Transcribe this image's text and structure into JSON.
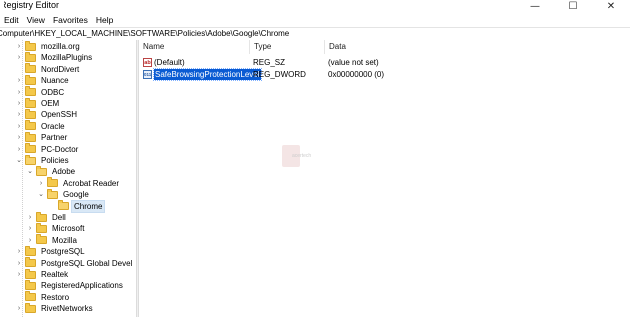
{
  "window": {
    "title": "Registry Editor",
    "minimize": "—",
    "maximize": "☐",
    "close": "✕"
  },
  "menu": [
    "Edit",
    "View",
    "Favorites",
    "Help"
  ],
  "address": "Computer\\HKEY_LOCAL_MACHINE\\SOFTWARE\\Policies\\Adobe\\Google\\Chrome",
  "tree": [
    {
      "label": "mozilla.org",
      "expander": ">",
      "depth": 1
    },
    {
      "label": "MozillaPlugins",
      "expander": ">",
      "depth": 1
    },
    {
      "label": "NordDivert",
      "expander": "",
      "depth": 1
    },
    {
      "label": "Nuance",
      "expander": ">",
      "depth": 1
    },
    {
      "label": "ODBC",
      "expander": ">",
      "depth": 1
    },
    {
      "label": "OEM",
      "expander": ">",
      "depth": 1
    },
    {
      "label": "OpenSSH",
      "expander": ">",
      "depth": 1
    },
    {
      "label": "Oracle",
      "expander": ">",
      "depth": 1
    },
    {
      "label": "Partner",
      "expander": ">",
      "depth": 1
    },
    {
      "label": "PC-Doctor",
      "expander": ">",
      "depth": 1
    },
    {
      "label": "Policies",
      "expander": "v",
      "depth": 1
    },
    {
      "label": "Adobe",
      "expander": "v",
      "depth": 2
    },
    {
      "label": "Acrobat Reader",
      "expander": ">",
      "depth": 3
    },
    {
      "label": "Google",
      "expander": "v",
      "depth": 3
    },
    {
      "label": "Chrome",
      "expander": "",
      "depth": 4,
      "selected": true
    },
    {
      "label": "Dell",
      "expander": ">",
      "depth": 2
    },
    {
      "label": "Microsoft",
      "expander": ">",
      "depth": 2
    },
    {
      "label": "Mozilla",
      "expander": ">",
      "depth": 2
    },
    {
      "label": "PostgreSQL",
      "expander": ">",
      "depth": 1
    },
    {
      "label": "PostgreSQL Global Devel",
      "expander": ">",
      "depth": 1
    },
    {
      "label": "Realtek",
      "expander": ">",
      "depth": 1
    },
    {
      "label": "RegisteredApplications",
      "expander": "",
      "depth": 1
    },
    {
      "label": "Restoro",
      "expander": "",
      "depth": 1
    },
    {
      "label": "RivetNetworks",
      "expander": ">",
      "depth": 1
    }
  ],
  "columns": {
    "name": "Name",
    "type": "Type",
    "data": "Data"
  },
  "values": [
    {
      "name": "(Default)",
      "type": "REG_SZ",
      "data": "(value not set)",
      "icon": "ab",
      "selected": false
    },
    {
      "name": "SafeBrowsingProtectionLevel",
      "type": "REG_DWORD",
      "data": "0x00000000 (0)",
      "icon": "011",
      "selected": true
    }
  ],
  "watermark": "acertech"
}
